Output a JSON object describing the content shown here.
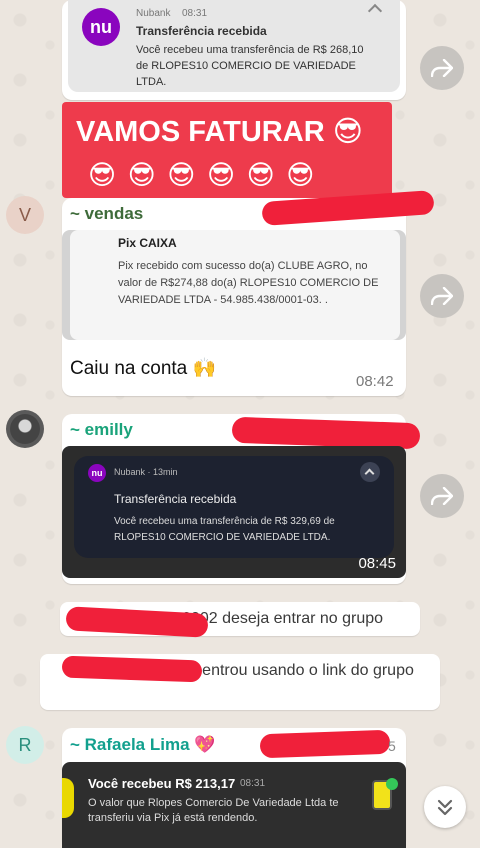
{
  "msg1": {
    "app": "Nubank",
    "time": "08:31",
    "title": "Transferência recebida",
    "body": "Você recebeu uma transferência de R$ 268,10 de RLOPES10 COMERCIO DE VARIEDADE LTDA."
  },
  "banner": {
    "line1": "VAMOS FATURAR 😎",
    "line2": "😎 😎 😎 😎 😎 😎"
  },
  "msg2": {
    "avatar_letter": "V",
    "sender": "~ vendas",
    "notif_title": "Pix CAIXA",
    "notif_body": "Pix recebido com sucesso do(a) CLUBE AGRO, no valor de R$274,88 do(a) RLOPES10 COMERCIO DE VARIEDADE LTDA - 54.985.438/0001-03. .",
    "text": "Caiu na conta 🙌",
    "time": "08:42"
  },
  "msg3": {
    "sender": "~ emilly",
    "app": "Nubank · 13min",
    "title": "Transferência recebida",
    "body": "Você recebeu uma transferência de R$ 329,69 de RLOPES10 COMERCIO DE VARIEDADE LTDA.",
    "time": "08:45"
  },
  "system": {
    "join_request": "199-0002 deseja entrar no grupo",
    "joined_link": "0002 entrou usando o link do grupo"
  },
  "msg4": {
    "avatar_letter": "R",
    "sender": "~ Rafaela Lima 💖",
    "sender_suffix": "5",
    "heading": "Você recebeu R$ 213,17",
    "heading_time": "08:31",
    "body": "O valor que Rlopes Comercio De Variedade Ltda te transferiu via Pix já está rendendo."
  },
  "colors": {
    "redaction": "#f0203a",
    "vendas_name": "#3e6b3a",
    "emilly_name": "#1aa37a",
    "rafaela_name": "#12a08e",
    "banner_bg": "#ee3b4c",
    "nubank_purple": "#8a05be"
  },
  "icons": [
    "nubank-logo-icon",
    "forward-icon",
    "chevron-up-icon",
    "scroll-down-icon"
  ]
}
